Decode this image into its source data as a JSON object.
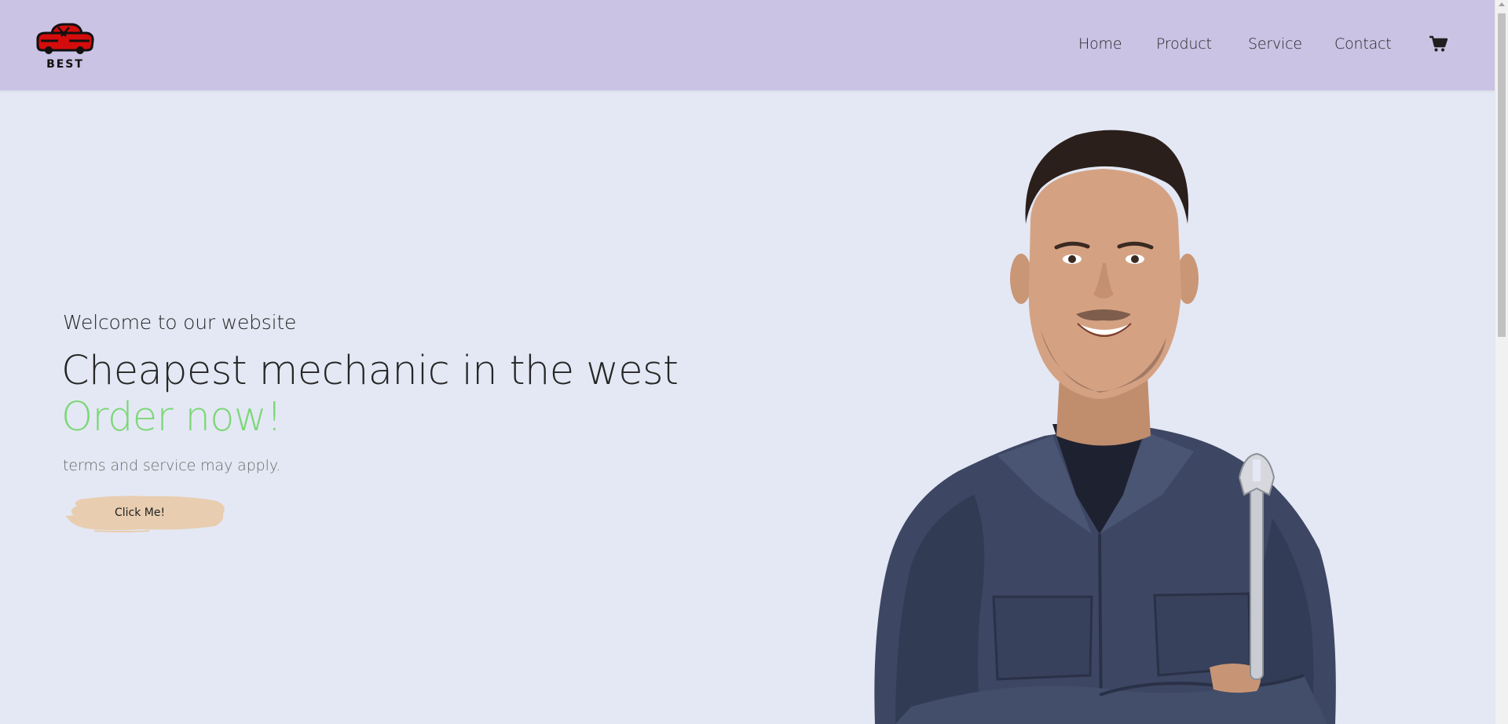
{
  "header": {
    "logo_text": "BEST",
    "nav": {
      "home": "Home",
      "product": "Product",
      "service": "Service",
      "contact": "Contact"
    },
    "cart_icon": "shopping-cart-icon"
  },
  "hero": {
    "welcome": "Welcome to our website",
    "headline": "Cheapest mechanic in the west",
    "cta_highlight": "Order now!",
    "terms": "terms and service may apply.",
    "button_label": "Click Me!",
    "image": "mechanic-photo"
  },
  "colors": {
    "header_bg": "#cac3e4",
    "page_bg": "#e4e8f4",
    "accent_green": "#7cd777",
    "button_bg": "#e8cdb0",
    "logo_red": "#d40c0c"
  }
}
